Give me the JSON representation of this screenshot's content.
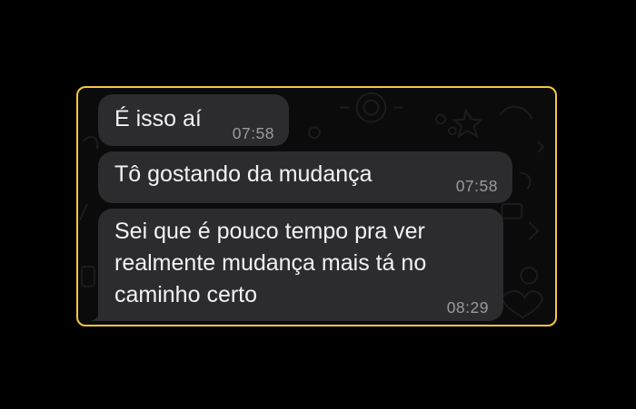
{
  "chat": {
    "accent_border": "#f5c542",
    "bubble_color": "#2c2c2e",
    "messages": [
      {
        "text": "É isso aí",
        "time": "07:58"
      },
      {
        "text": "Tô gostando da mudança",
        "time": "07:58"
      },
      {
        "text": "Sei que é pouco tempo pra ver\nrealmente mudança mais tá no\ncaminho certo",
        "time": "08:29"
      }
    ]
  }
}
